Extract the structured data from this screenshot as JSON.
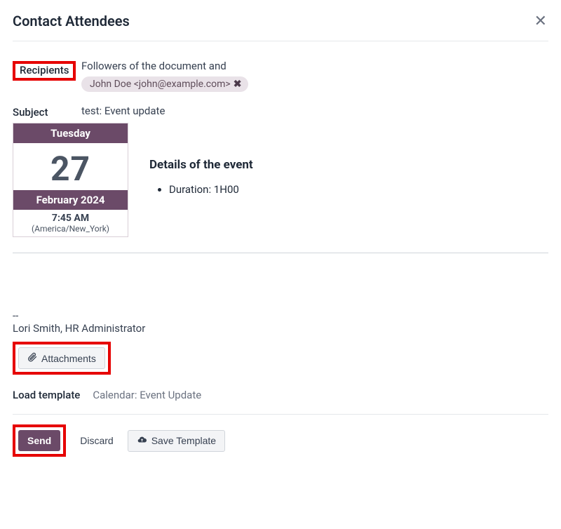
{
  "modal": {
    "title": "Contact Attendees"
  },
  "form": {
    "recipients_label": "Recipients",
    "recipients_text": "Followers of the document and",
    "recipient_tag": "John Doe <john@example.com>",
    "subject_label": "Subject",
    "subject_value": "test: Event update"
  },
  "calendar": {
    "weekday": "Tuesday",
    "day": "27",
    "month_year": "February 2024",
    "time": "7:45 AM",
    "timezone": "(America/New_York)"
  },
  "details": {
    "title": "Details of the event",
    "items": [
      "Duration: 1H00"
    ]
  },
  "signature": {
    "sep": "--",
    "name": "Lori Smith, HR Administrator"
  },
  "buttons": {
    "attachments": "Attachments",
    "send": "Send",
    "discard": "Discard",
    "save_template": "Save Template"
  },
  "load_template": {
    "label": "Load template",
    "value": "Calendar: Event Update"
  }
}
